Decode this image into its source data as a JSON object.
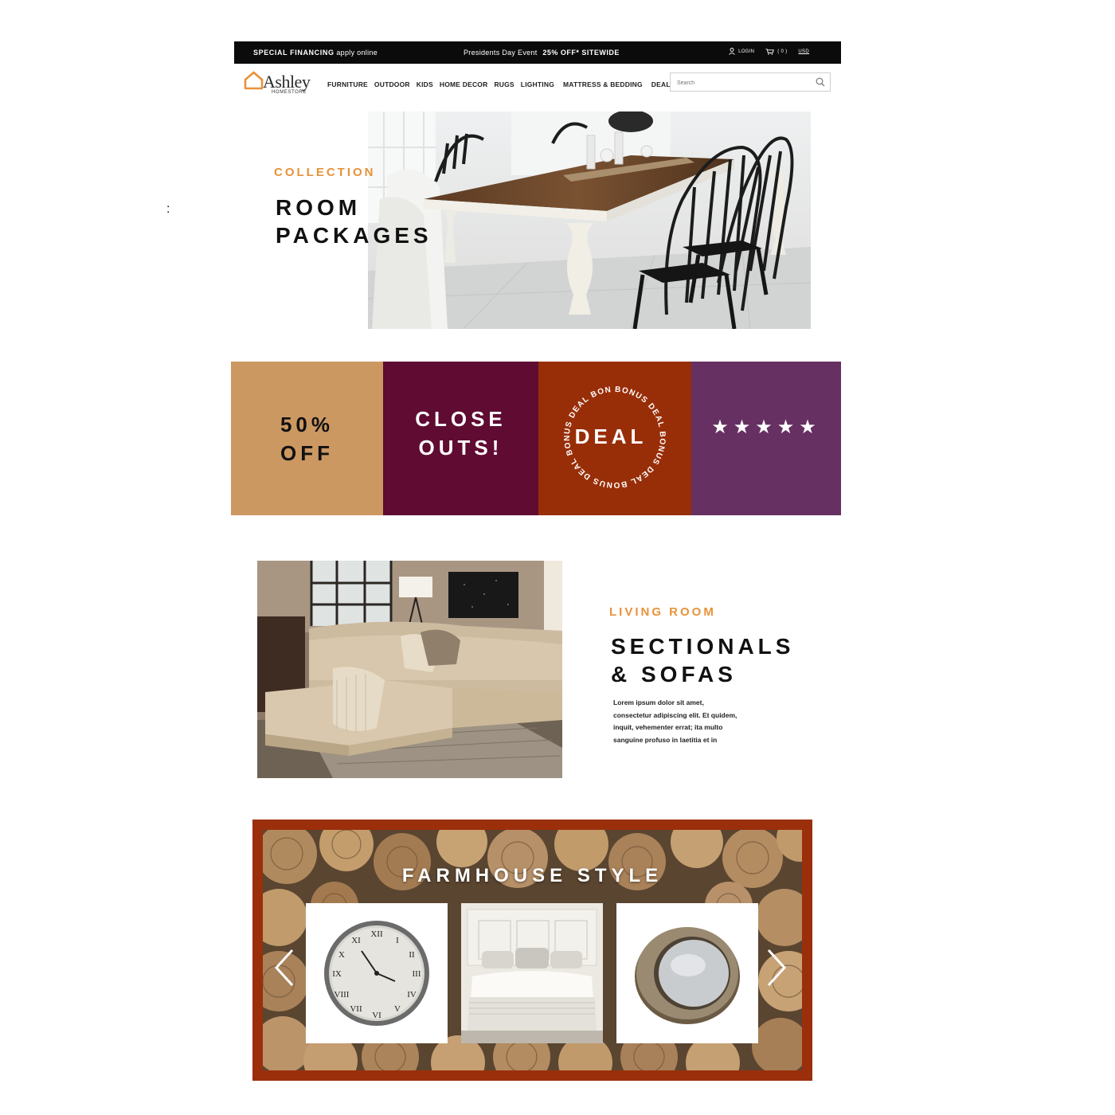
{
  "topbar": {
    "financing_bold": "SPECIAL FINANCING",
    "financing_rest": "apply online",
    "event": "Presidents Day Event",
    "event_offer": "25% OFF* SITEWIDE",
    "login": "LOGIN",
    "cart": "( 0 )",
    "currency": "USD"
  },
  "brand": {
    "name": "Ashley",
    "sub": "HOMESTORE",
    "accent": "#e8923a"
  },
  "nav": [
    "FURNITURE",
    "OUTDOOR",
    "KIDS",
    "HOME DECOR",
    "RUGS",
    "LIGHTING",
    "MATTRESS & BEDDING",
    "DEALS"
  ],
  "search": {
    "placeholder": "Search"
  },
  "stray_mark": ":",
  "hero": {
    "kicker": "COLLECTION",
    "title_line1": "ROOM",
    "title_line2": "PACKAGES"
  },
  "promos": {
    "tile1_line1": "50%",
    "tile1_line2": "OFF",
    "tile2_line1": "CLOSE",
    "tile2_line2": "OUTS!",
    "tile3_center": "DEAL",
    "tile3_ring": "BONUS DEAL BONUS DEAL BONUS DEAL BONUS DEAL BONUS DEAL ",
    "tile4_stars": "★★★★★",
    "colors": {
      "tan": "#cc9862",
      "wine": "#5f0b32",
      "rust": "#982e08",
      "plum": "#673062"
    }
  },
  "living": {
    "kicker": "LIVING ROOM",
    "title_line1": "SECTIONALS",
    "title_line2": "& SOFAS",
    "body_line1": "Lorem ipsum dolor sit amet,",
    "body_line2": "consectetur adipiscing elit. Et quidem,",
    "body_line3": "inquit, vehementer errat; ita multo",
    "body_line4": "sanguine profuso in laetitia et in"
  },
  "farmhouse": {
    "title": "FARMHOUSE STYLE",
    "products": [
      "wall-clock",
      "white-bed",
      "round-metal-mirror"
    ]
  }
}
